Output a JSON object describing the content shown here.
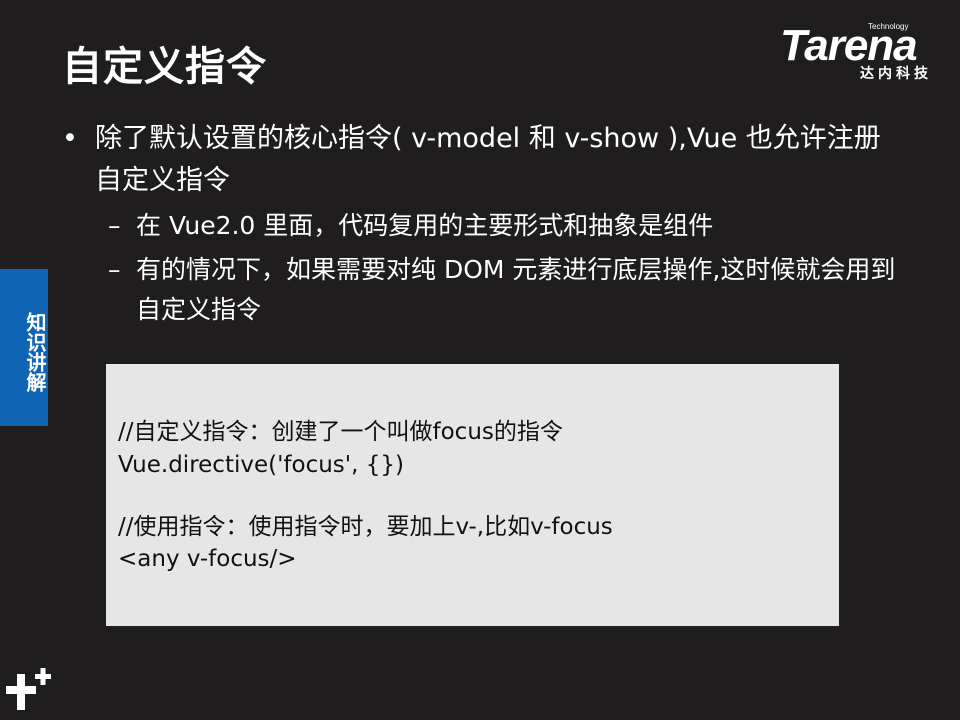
{
  "slide": {
    "title": "自定义指令"
  },
  "logo": {
    "tagline": "Technology",
    "brand": "Tarena",
    "brand_cn": "达内科技"
  },
  "side_tab": {
    "label": "知识讲解"
  },
  "bullets": {
    "lvl1_marker": "•",
    "lvl2_marker": "–",
    "item1": "除了默认设置的核心指令( v-model 和 v-show ),Vue 也允许注册自定义指令",
    "sub1": "在 Vue2.0 里面，代码复用的主要形式和抽象是组件",
    "sub2": "有的情况下，如果需要对纯 DOM 元素进行底层操作,这时候就会用到自定义指令"
  },
  "code": {
    "line1": "//自定义指令：创建了一个叫做focus的指令",
    "line2": "Vue.directive('focus', {})",
    "line3": "//使用指令：使用指令时，要加上v-,比如v-focus",
    "line4": "<any v-focus/>"
  }
}
